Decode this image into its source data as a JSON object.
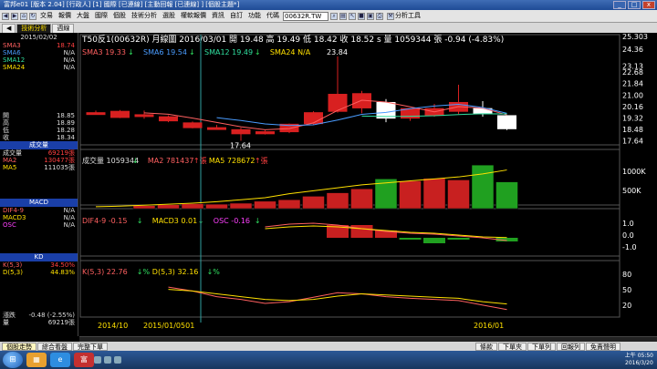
{
  "window": {
    "title": "富邦e01 [版本 2.04] [行政人] [1] 國際 [已連線] [主動回報 [已連線] ] [個股主題*]",
    "min_label": "_",
    "max_label": "□",
    "close_label": "x"
  },
  "toolbar": {
    "items": [
      "交易",
      "報價",
      "大盤",
      "國際",
      "個股",
      "技術分析",
      "選股",
      "權軟報價",
      "資訊",
      "自訂",
      "功能"
    ],
    "code_label": "代碼",
    "code_value": "00632R.TW",
    "tools_label": "分析工具"
  },
  "tabs": [
    "技術分析",
    "週線"
  ],
  "left": {
    "date": "2015/02/02",
    "ma_rows": [
      {
        "k": "SMA3",
        "v": "18.74",
        "kc": "#ff6060",
        "vc": "#ff4040"
      },
      {
        "k": "SMA6",
        "v": "N/A",
        "kc": "#4a9cff",
        "vc": "#ddd"
      },
      {
        "k": "SMA12",
        "v": "N/A",
        "kc": "#30e0a0",
        "vc": "#ddd"
      },
      {
        "k": "SMA24",
        "v": "N/A",
        "kc": "#ffe000",
        "vc": "#ddd"
      }
    ],
    "ohlc": [
      {
        "k": "開",
        "v": "18.85"
      },
      {
        "k": "高",
        "v": "18.89"
      },
      {
        "k": "低",
        "v": "18.28"
      },
      {
        "k": "收",
        "v": "18.34"
      }
    ],
    "vol_head": "成交量",
    "vol_rows": [
      {
        "k": "成交量",
        "v": "69219張",
        "kc": "#ddd",
        "vc": "#ff4040"
      },
      {
        "k": "MA2",
        "v": "130477張",
        "kc": "#ff6060",
        "vc": "#ff4040"
      },
      {
        "k": "MA5",
        "v": "111035張",
        "kc": "#ffe000",
        "vc": "#ddd"
      }
    ],
    "macd_head": "MACD",
    "macd_rows": [
      {
        "k": "DIF4-9",
        "v": "N/A",
        "kc": "#ff6060",
        "vc": "#ddd"
      },
      {
        "k": "MACD3",
        "v": "N/A",
        "kc": "#ffe000",
        "vc": "#ddd"
      },
      {
        "k": "OSC",
        "v": "N/A",
        "kc": "#ff40ff",
        "vc": "#ddd"
      }
    ],
    "kd_head": "KD",
    "kd_rows": [
      {
        "k": "K(5,3)",
        "v": "34.50%",
        "kc": "#ff6060",
        "vc": "#ff4040"
      },
      {
        "k": "D(5,3)",
        "v": "44.83%",
        "kc": "#ffe000",
        "vc": "#ffe000"
      }
    ],
    "bottom_rows": [
      {
        "k": "漲跌",
        "v": "-0.48 (-2.55%)"
      },
      {
        "k": "量",
        "v": "69219張"
      }
    ]
  },
  "chart": {
    "header": "T50反1(00632R)   月線圖   2016/03/01   開 19.48   高 19.49   低 18.42   收 18.52 s   量 1059344 張   -0.94 (-4.83%)",
    "ma_legend": [
      {
        "t": "SMA3 19.33",
        "c": "#ff6060",
        "arrow": "↓"
      },
      {
        "t": "SMA6 19.54",
        "c": "#4a9cff",
        "arrow": "↓"
      },
      {
        "t": "SMA12 19.49",
        "c": "#30e0a0",
        "arrow": "↓"
      },
      {
        "t": "SMA24 N/A",
        "c": "#ffe000",
        "arrow": ""
      }
    ],
    "vol_legend": [
      {
        "t": "成交量 1059344",
        "c": "#ddd",
        "arrow": "↓"
      },
      {
        "t": "MA2 781437",
        "c": "#ff6060",
        "arrow": "↑張"
      },
      {
        "t": "MA5 728672",
        "c": "#ffe000",
        "arrow": "↑張"
      }
    ],
    "macd_legend": [
      {
        "t": "DIF4-9 -0.15",
        "c": "#ff6060",
        "arrow": "↓"
      },
      {
        "t": "MACD3 0.01",
        "c": "#ffe000",
        "arrow": "↓"
      },
      {
        "t": "OSC -0.16",
        "c": "#ff40ff",
        "arrow": "↓"
      }
    ],
    "kd_legend": [
      {
        "t": "K(5,3) 22.76",
        "c": "#ff6060",
        "arrow": "↓%"
      },
      {
        "t": "D(5,3) 32.16",
        "c": "#ffe000",
        "arrow": "↓%"
      }
    ],
    "price_axis": [
      "25.303",
      "24.36",
      "23.13",
      "22.68",
      "21.84",
      "21.00",
      "20.16",
      "19.32",
      "18.48",
      "17.64"
    ],
    "vol_axis": [
      "1000K",
      "500K"
    ],
    "macd_axis": [
      "1.0",
      "0.0",
      "-1.0"
    ],
    "kd_axis": [
      "80",
      "50",
      "20"
    ],
    "time_axis": [
      "2014/10",
      "2015/01/0501",
      "2016/01"
    ],
    "hi_label": "23.84",
    "lo_label": "17.64"
  },
  "chart_data": {
    "type": "candlestick",
    "price_min": 17.0,
    "price_max": 25.303,
    "candles": [
      {
        "o": 19.7,
        "h": 19.85,
        "l": 19.6,
        "c": 19.7
      },
      {
        "o": 19.35,
        "h": 19.9,
        "l": 19.3,
        "c": 19.8
      },
      {
        "o": 19.5,
        "h": 19.85,
        "l": 19.25,
        "c": 19.55
      },
      {
        "o": 19.1,
        "h": 19.5,
        "l": 19.0,
        "c": 19.4
      },
      {
        "o": 18.6,
        "h": 19.05,
        "l": 18.55,
        "c": 18.95
      },
      {
        "o": 18.55,
        "h": 18.8,
        "l": 18.45,
        "c": 18.6
      },
      {
        "o": 18.15,
        "h": 18.6,
        "l": 17.64,
        "c": 18.45
      },
      {
        "o": 18.15,
        "h": 18.4,
        "l": 18.1,
        "c": 18.3
      },
      {
        "o": 18.3,
        "h": 18.9,
        "l": 18.2,
        "c": 18.85
      },
      {
        "o": 18.9,
        "h": 19.8,
        "l": 18.8,
        "c": 19.7
      },
      {
        "o": 19.8,
        "h": 23.84,
        "l": 19.7,
        "c": 21.05
      },
      {
        "o": 20.05,
        "h": 21.3,
        "l": 19.65,
        "c": 21.1
      },
      {
        "o": 20.45,
        "h": 20.7,
        "l": 19.0,
        "c": 19.3
      },
      {
        "o": 19.3,
        "h": 20.0,
        "l": 19.1,
        "c": 20.0
      },
      {
        "o": 19.5,
        "h": 20.35,
        "l": 19.4,
        "c": 20.0
      },
      {
        "o": 19.8,
        "h": 21.75,
        "l": 19.6,
        "c": 20.45
      },
      {
        "o": 20.0,
        "h": 20.55,
        "l": 19.4,
        "c": 19.65
      },
      {
        "o": 19.48,
        "h": 19.49,
        "l": 18.42,
        "c": 18.52
      }
    ],
    "volumes": [
      0,
      0,
      60,
      80,
      100,
      90,
      110,
      150,
      180,
      250,
      320,
      400,
      600,
      560,
      610,
      580,
      880,
      540,
      1059
    ],
    "vol_max": 1250,
    "vol_ma": [
      40,
      50,
      70,
      90,
      110,
      140,
      180,
      220,
      300,
      360,
      420,
      480,
      520,
      560,
      600,
      640,
      700,
      780
    ],
    "osc": [
      0,
      0,
      0,
      0,
      0,
      0,
      0,
      0,
      0,
      0,
      0.7,
      0.7,
      0.4,
      -0.1,
      -0.3,
      -0.1,
      0.0,
      -0.2,
      -0.5
    ],
    "dif": [
      0.6,
      0.75,
      0.8,
      0.7,
      0.5,
      0.35,
      0.25,
      0.2,
      0.1,
      0.0,
      -0.15
    ],
    "macd": [
      0.5,
      0.6,
      0.65,
      0.6,
      0.5,
      0.4,
      0.3,
      0.25,
      0.15,
      0.05,
      0.01
    ],
    "k": [
      62,
      55,
      45,
      40,
      33,
      36,
      44,
      52,
      50,
      45,
      42,
      40,
      38,
      30,
      22
    ],
    "d": [
      58,
      55,
      50,
      45,
      40,
      38,
      40,
      46,
      50,
      48,
      46,
      44,
      42,
      36,
      32
    ]
  },
  "bottom_tabs": [
    "個股走勢",
    "綜合看盤",
    "完整下單"
  ],
  "bottom_right_tabs": [
    "條款",
    "下單夾",
    "下單列",
    "回報列",
    "免責聲明"
  ],
  "taskbar": {
    "start_label": "⊞",
    "time": "上午 05:50",
    "date": "2016/3/20"
  }
}
